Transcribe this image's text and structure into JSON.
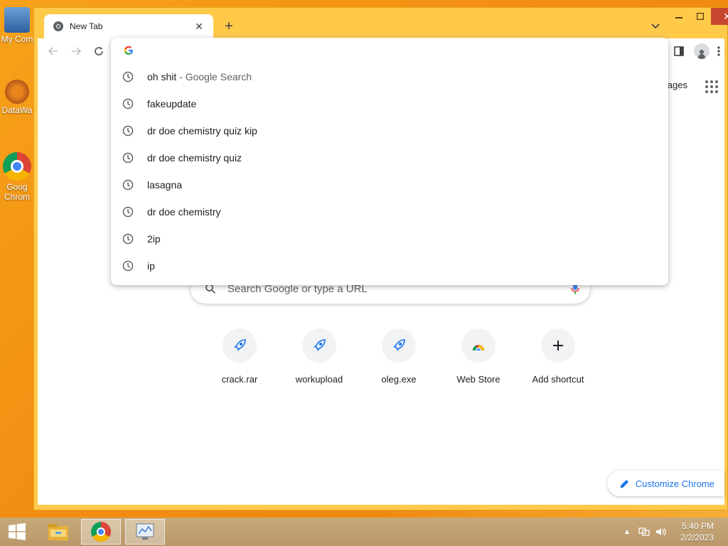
{
  "desktop": {
    "icons": [
      {
        "label": "My Com"
      },
      {
        "label": "DataWa"
      },
      {
        "label": "Goog Chrom"
      }
    ]
  },
  "browser": {
    "tab": {
      "title": "New Tab"
    },
    "toolbar": {},
    "omnibox": {
      "suggestions": [
        {
          "text": "oh shit",
          "desc": " - Google Search"
        },
        {
          "text": "fakeupdate",
          "desc": ""
        },
        {
          "text": "dr doe chemistry quiz kip",
          "desc": ""
        },
        {
          "text": "dr doe chemistry quiz",
          "desc": ""
        },
        {
          "text": "lasagna",
          "desc": ""
        },
        {
          "text": "dr doe chemistry",
          "desc": ""
        },
        {
          "text": "2ip",
          "desc": ""
        },
        {
          "text": "ip",
          "desc": ""
        }
      ]
    },
    "newtab": {
      "images_link": "nages",
      "search_placeholder": "Search Google or type a URL",
      "shortcuts": [
        {
          "label": "crack.rar",
          "icon": "rocket-icon"
        },
        {
          "label": "workupload",
          "icon": "rocket-icon"
        },
        {
          "label": "oleg.exe",
          "icon": "rocket-icon"
        },
        {
          "label": "Web Store",
          "icon": "web-store-icon"
        },
        {
          "label": "Add shortcut",
          "icon": "plus-icon"
        }
      ],
      "customize_label": "Customize Chrome"
    }
  },
  "taskbar": {
    "time": "5:40 PM",
    "date": "2/2/2023"
  }
}
